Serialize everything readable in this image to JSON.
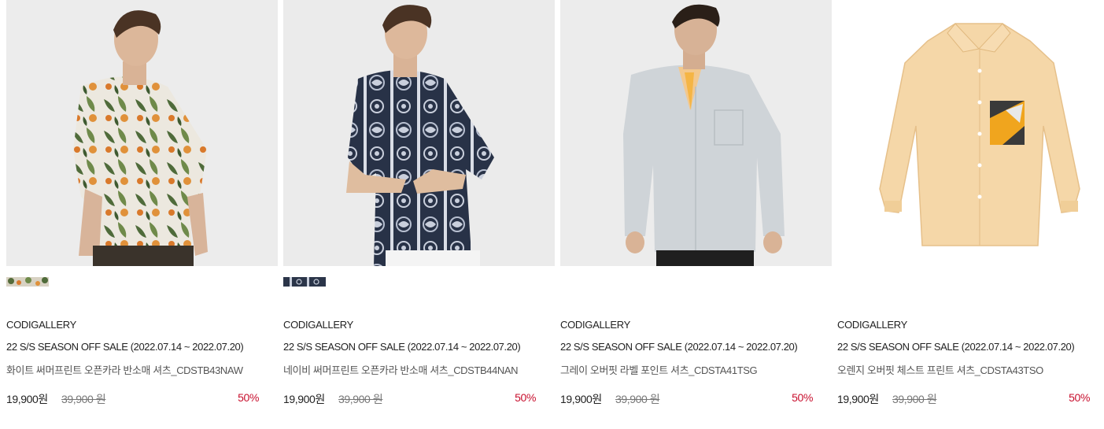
{
  "products": [
    {
      "brand": "CODIGALLERY",
      "event": "22 S/S SEASON OFF SALE (2022.07.14 ~ 2022.07.20)",
      "name": "화이트 써머프린트 오픈카라 반소매 셔츠_CDSTB43NAW",
      "price": "19,900원",
      "original_price": "39,900 원",
      "discount": "50%",
      "image": "white-tropical-print-shirt-model",
      "swatch": "tropical-swatch"
    },
    {
      "brand": "CODIGALLERY",
      "event": "22 S/S SEASON OFF SALE (2022.07.14 ~ 2022.07.20)",
      "name": "네이비 써머프린트 오픈카라 반소매 셔츠_CDSTB44NAN",
      "price": "19,900원",
      "original_price": "39,900 원",
      "discount": "50%",
      "image": "navy-paisley-print-shirt-model",
      "swatch": "paisley-swatch"
    },
    {
      "brand": "CODIGALLERY",
      "event": "22 S/S SEASON OFF SALE (2022.07.14 ~ 2022.07.20)",
      "name": "그레이 오버핏 라벨 포인트 셔츠_CDSTA41TSG",
      "price": "19,900원",
      "original_price": "39,900 원",
      "discount": "50%",
      "image": "grey-overfit-shirt-model"
    },
    {
      "brand": "CODIGALLERY",
      "event": "22 S/S SEASON OFF SALE (2022.07.14 ~ 2022.07.20)",
      "name": "오렌지 오버핏 체스트 프린트 셔츠_CDSTA43TSO",
      "price": "19,900원",
      "original_price": "39,900 원",
      "discount": "50%",
      "image": "orange-chest-print-shirt-flatlay"
    }
  ],
  "colors": {
    "discount": "#c8102e",
    "photo_background": "#ebebeb",
    "text": "#222222",
    "muted_text": "#777777"
  }
}
